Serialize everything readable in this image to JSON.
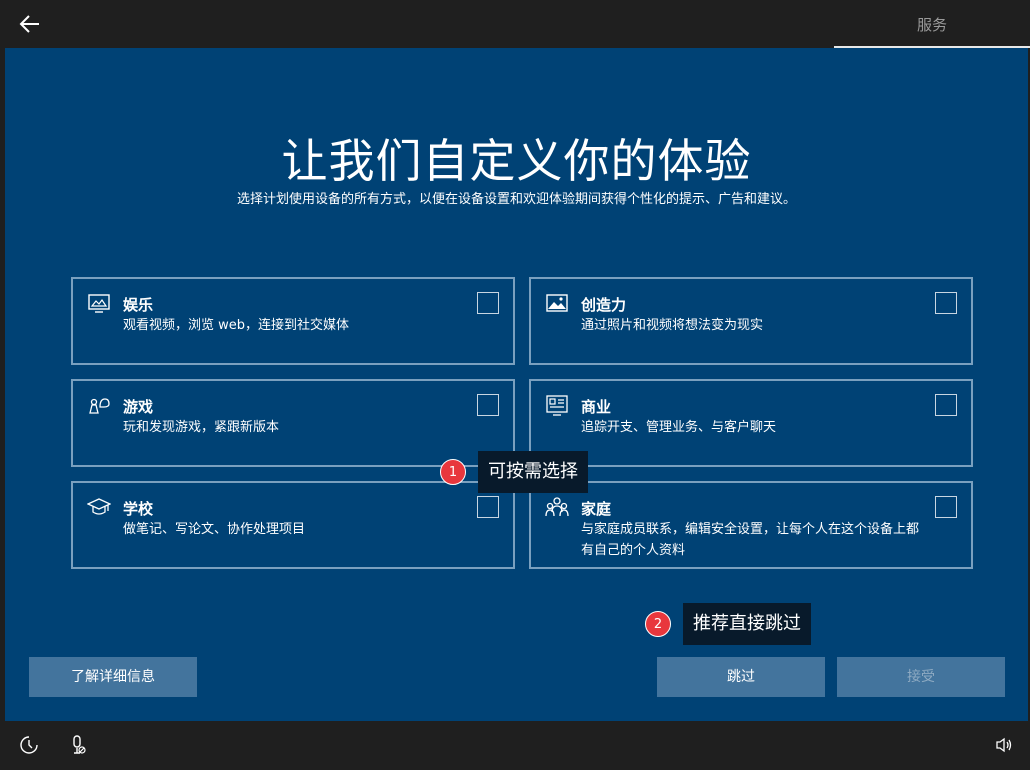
{
  "header": {
    "service_tab": "服务"
  },
  "main": {
    "title": "让我们自定义你的体验",
    "subtitle": "选择计划使用设备的所有方式，以便在设备设置和欢迎体验期间获得个性化的提示、广告和建议。"
  },
  "cards": [
    {
      "title": "娱乐",
      "desc": "观看视频，浏览 web，连接到社交媒体",
      "icon": "entertainment-icon"
    },
    {
      "title": "创造力",
      "desc": "通过照片和视频将想法变为现实",
      "icon": "image-icon"
    },
    {
      "title": "游戏",
      "desc": "玩和发现游戏，紧跟新版本",
      "icon": "game-icon"
    },
    {
      "title": "商业",
      "desc": "追踪开支、管理业务、与客户聊天",
      "icon": "business-icon"
    },
    {
      "title": "学校",
      "desc": "做笔记、写论文、协作处理项目",
      "icon": "graduation-cap-icon"
    },
    {
      "title": "家庭",
      "desc": "与家庭成员联系，编辑安全设置，让每个人在这个设备上都有自己的个人资料",
      "icon": "family-icon"
    }
  ],
  "buttons": {
    "learn_more": "了解详细信息",
    "skip": "跳过",
    "accept": "接受"
  },
  "annotations": [
    {
      "num": "1",
      "text": "可按需选择"
    },
    {
      "num": "2",
      "text": "推荐直接跳过"
    }
  ],
  "colors": {
    "accent_bg": "#004275",
    "button": "#43749d",
    "badge": "#e8373d"
  }
}
